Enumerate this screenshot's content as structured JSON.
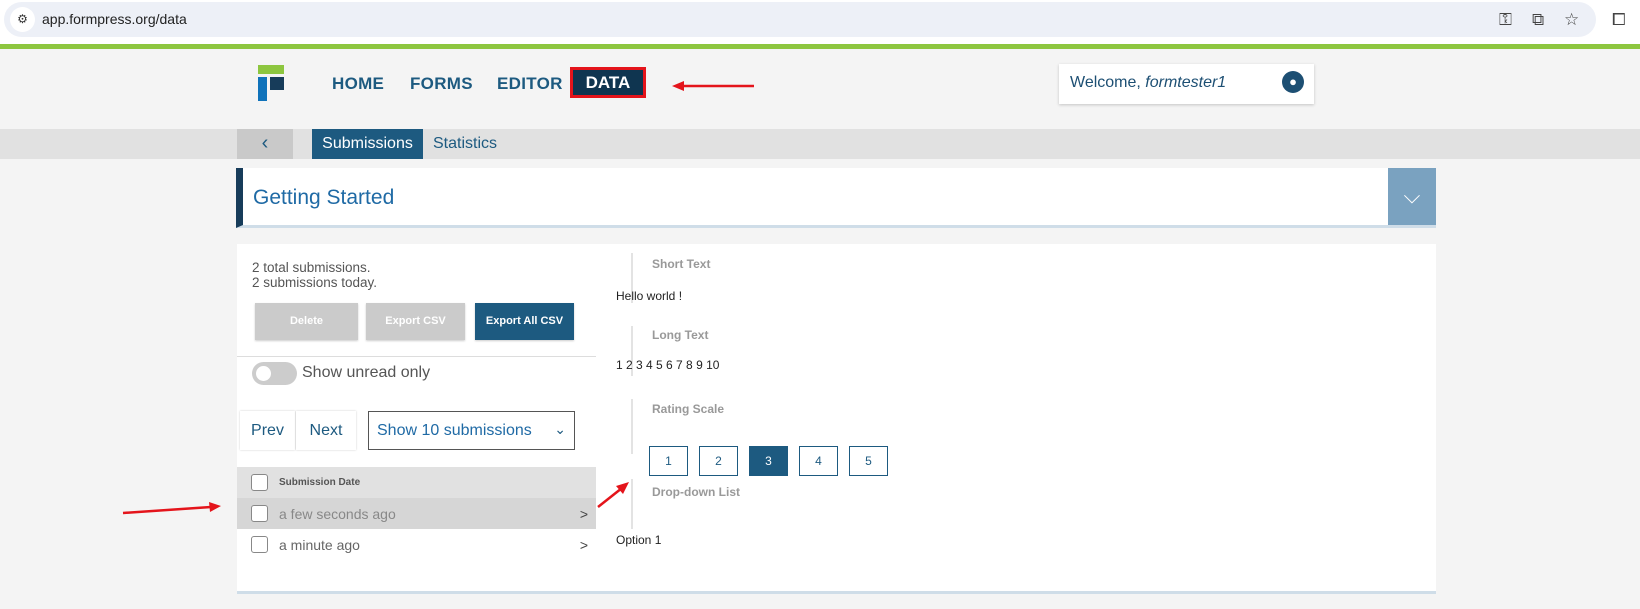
{
  "browser": {
    "url": "app.formpress.org/data",
    "icons": [
      "site-settings-icon",
      "key-icon",
      "translate-icon",
      "star-icon",
      "extensions-icon"
    ]
  },
  "header": {
    "nav": [
      {
        "label": "HOME"
      },
      {
        "label": "FORMS"
      },
      {
        "label": "EDITOR"
      },
      {
        "label": "DATA",
        "active": true
      }
    ],
    "welcome_prefix": "Welcome, ",
    "username": "formtester1"
  },
  "subnav": {
    "tabs": [
      {
        "label": "Submissions",
        "active": true
      },
      {
        "label": "Statistics"
      }
    ]
  },
  "form": {
    "title": "Getting Started"
  },
  "submissions": {
    "total": "2 total submissions.",
    "today": "2 submissions today.",
    "buttons": {
      "delete": "Delete",
      "export": "Export CSV",
      "export_all": "Export All CSV"
    },
    "toggle_label": "Show unread only",
    "toggle_on": false,
    "prev": "Prev",
    "next": "Next",
    "page_size": "Show 10 submissions",
    "column": "Submission Date",
    "rows": [
      {
        "date": "a few seconds ago",
        "selected": true
      },
      {
        "date": "a minute ago"
      }
    ],
    "row_arrow": ">"
  },
  "detail": {
    "fields": [
      {
        "label": "Short Text",
        "value": "Hello world !"
      },
      {
        "label": "Long Text",
        "value": "1 2 3 4 5 6 7 8 9 10"
      },
      {
        "label": "Rating Scale",
        "options": [
          "1",
          "2",
          "3",
          "4",
          "5"
        ],
        "selected": "3"
      },
      {
        "label": "Drop-down List",
        "value": "Option 1"
      }
    ]
  },
  "colors": {
    "accent": "#1d5a80",
    "brand_green": "#8dc63f",
    "annotation": "#e4141b"
  }
}
